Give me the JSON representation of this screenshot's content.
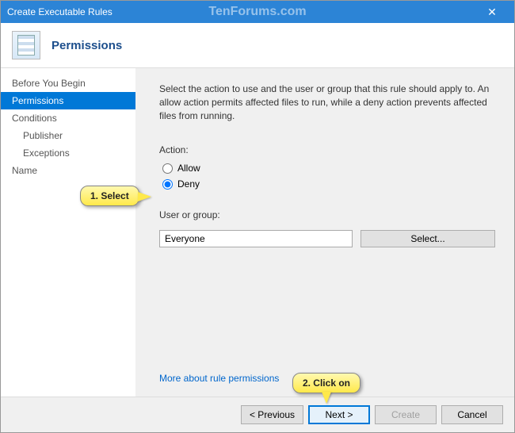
{
  "titlebar": {
    "title": "Create Executable Rules",
    "watermark": "TenForums.com",
    "close": "✕"
  },
  "header": {
    "title": "Permissions"
  },
  "sidebar": {
    "items": [
      {
        "label": "Before You Begin",
        "level": 1,
        "active": false
      },
      {
        "label": "Permissions",
        "level": 1,
        "active": true
      },
      {
        "label": "Conditions",
        "level": 1,
        "active": false
      },
      {
        "label": "Publisher",
        "level": 2,
        "active": false
      },
      {
        "label": "Exceptions",
        "level": 2,
        "active": false
      },
      {
        "label": "Name",
        "level": 1,
        "active": false
      }
    ]
  },
  "content": {
    "instructions": "Select the action to use and the user or group that this rule should apply to. An allow action permits affected files to run, while a deny action prevents affected files from running.",
    "action_label": "Action:",
    "allow_label": "Allow",
    "deny_label": "Deny",
    "selected_action": "deny",
    "user_group_label": "User or group:",
    "user_group_value": "Everyone",
    "select_button": "Select...",
    "more_link": "More about rule permissions"
  },
  "footer": {
    "previous": "< Previous",
    "next": "Next >",
    "create": "Create",
    "cancel": "Cancel"
  },
  "callouts": {
    "c1": "1. Select",
    "c2": "2. Click on"
  }
}
